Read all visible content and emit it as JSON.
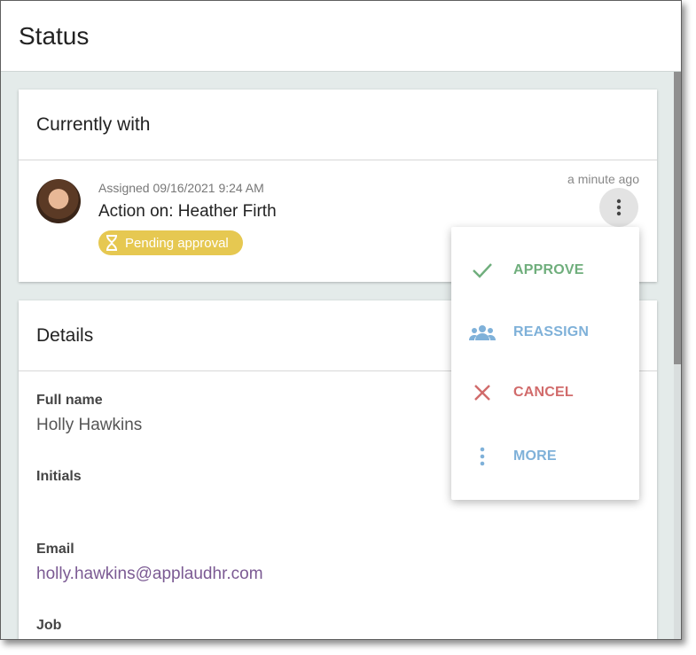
{
  "window": {
    "title": "Status"
  },
  "currently_with": {
    "header": "Currently with",
    "assigned": "Assigned 09/16/2021 9:24 AM",
    "action": "Action on: Heather Firth",
    "badge": "Pending approval",
    "time_ago": "a minute ago"
  },
  "details": {
    "header": "Details",
    "full_name_label": "Full name",
    "full_name_value": "Holly Hawkins",
    "initials_label": "Initials",
    "email_label": "Email",
    "email_value": "holly.hawkins@applaudhr.com",
    "job_label": "Job"
  },
  "menu": {
    "approve": "APPROVE",
    "reassign": "REASSIGN",
    "cancel": "CANCEL",
    "more": "MORE"
  },
  "colors": {
    "approve": "#6fae7c",
    "reassign": "#7fb1d9",
    "cancel": "#d16b6b",
    "badge": "#e6c851"
  }
}
